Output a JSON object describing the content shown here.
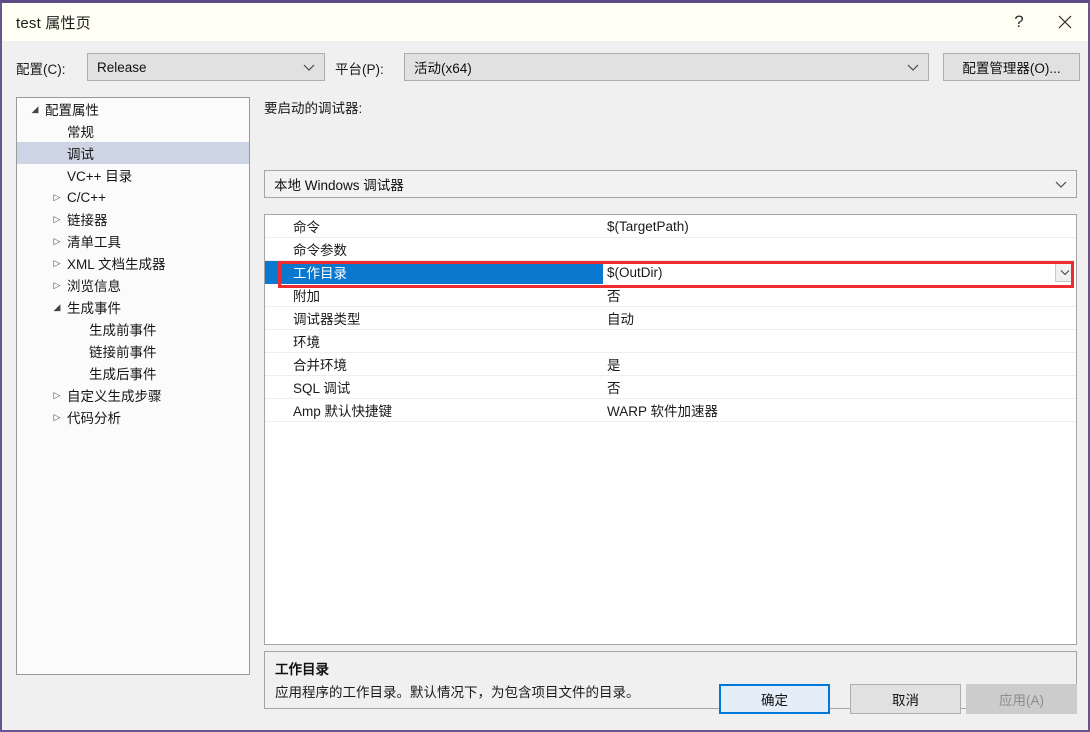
{
  "window": {
    "title": "test 属性页",
    "help_icon": "question-mark-icon",
    "close_icon": "close-icon"
  },
  "config_bar": {
    "config_label": "配置(C):",
    "config_value": "Release",
    "platform_label": "平台(P):",
    "platform_value": "活动(x64)",
    "config_manager_button": "配置管理器(O)..."
  },
  "tree": {
    "items": [
      {
        "label": "配置属性",
        "indent": 0,
        "arrow": "expanded",
        "selected": false
      },
      {
        "label": "常规",
        "indent": 1,
        "arrow": "none",
        "selected": false
      },
      {
        "label": "调试",
        "indent": 1,
        "arrow": "none",
        "selected": true
      },
      {
        "label": "VC++ 目录",
        "indent": 1,
        "arrow": "none",
        "selected": false
      },
      {
        "label": "C/C++",
        "indent": 1,
        "arrow": "collapsed",
        "selected": false
      },
      {
        "label": "链接器",
        "indent": 1,
        "arrow": "collapsed",
        "selected": false
      },
      {
        "label": "清单工具",
        "indent": 1,
        "arrow": "collapsed",
        "selected": false
      },
      {
        "label": "XML 文档生成器",
        "indent": 1,
        "arrow": "collapsed",
        "selected": false
      },
      {
        "label": "浏览信息",
        "indent": 1,
        "arrow": "collapsed",
        "selected": false
      },
      {
        "label": "生成事件",
        "indent": 1,
        "arrow": "expanded",
        "selected": false
      },
      {
        "label": "生成前事件",
        "indent": 2,
        "arrow": "none",
        "selected": false
      },
      {
        "label": "链接前事件",
        "indent": 2,
        "arrow": "none",
        "selected": false
      },
      {
        "label": "生成后事件",
        "indent": 2,
        "arrow": "none",
        "selected": false
      },
      {
        "label": "自定义生成步骤",
        "indent": 1,
        "arrow": "collapsed",
        "selected": false
      },
      {
        "label": "代码分析",
        "indent": 1,
        "arrow": "collapsed",
        "selected": false
      }
    ]
  },
  "main": {
    "launcher_label": "要启动的调试器:",
    "launcher_value": "本地 Windows 调试器",
    "grid_rows": [
      {
        "name": "命令",
        "value": "$(TargetPath)",
        "selected": false
      },
      {
        "name": "命令参数",
        "value": "",
        "selected": false
      },
      {
        "name": "工作目录",
        "value": "$(OutDir)",
        "selected": true
      },
      {
        "name": "附加",
        "value": "否",
        "selected": false
      },
      {
        "name": "调试器类型",
        "value": "自动",
        "selected": false
      },
      {
        "name": "环境",
        "value": "",
        "selected": false
      },
      {
        "name": "合并环境",
        "value": "是",
        "selected": false
      },
      {
        "name": "SQL 调试",
        "value": "否",
        "selected": false
      },
      {
        "name": "Amp 默认快捷键",
        "value": "WARP 软件加速器",
        "selected": false
      }
    ]
  },
  "description": {
    "title": "工作目录",
    "body": "应用程序的工作目录。默认情况下，为包含项目文件的目录。"
  },
  "footer": {
    "ok": "确定",
    "cancel": "取消",
    "apply": "应用(A)"
  },
  "colors": {
    "selection_blue": "#0b78d0",
    "highlight_red": "#ef2b2b",
    "tree_selection": "#cdd4e4",
    "focus_border": "#0078d7",
    "window_border": "#68548f"
  }
}
